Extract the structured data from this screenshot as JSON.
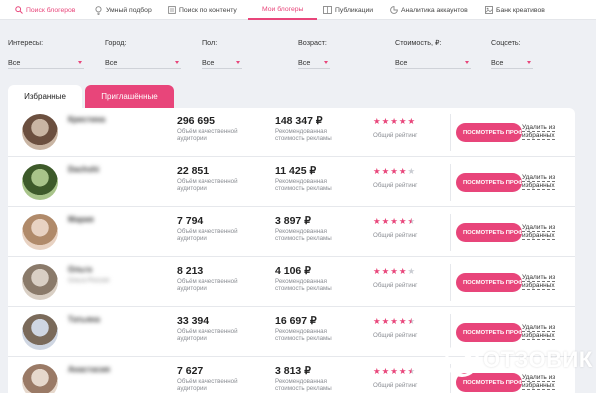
{
  "nav": {
    "items": [
      {
        "label": "Поиск блогеров",
        "icon": "search-icon"
      },
      {
        "label": "Умный подбор",
        "icon": "lightbulb-icon"
      },
      {
        "label": "Поиск по контенту",
        "icon": "content-search-icon"
      },
      {
        "label": "Мои блогеры",
        "icon": ""
      },
      {
        "label": "Публикации",
        "icon": "publications-icon"
      },
      {
        "label": "Аналитика аккаунтов",
        "icon": "analytics-icon"
      },
      {
        "label": "Банк креативов",
        "icon": "creatives-icon"
      }
    ],
    "active_index": 3
  },
  "filters": [
    {
      "label": "Интересы:",
      "value": "Все"
    },
    {
      "label": "Город:",
      "value": "Все"
    },
    {
      "label": "Пол:",
      "value": "Все"
    },
    {
      "label": "Возраст:",
      "value": "Все"
    },
    {
      "label": "Стоимость, ₽:",
      "value": "Все"
    },
    {
      "label": "Соцсеть:",
      "value": "Все"
    }
  ],
  "tabs": {
    "favorites": "Избранные",
    "invited": "Приглашённые"
  },
  "labels": {
    "audience_caption": "Объём качественной аудитории",
    "price_caption": "Рекомендованная стоимость рекламы",
    "rating_caption": "Общий рейтинг",
    "view_profile": "ПОСМОТРЕТЬ ПРОФИЛЬ",
    "remove": "Удалить из избранных"
  },
  "bloggers": [
    {
      "name": "Кристина",
      "sub": "",
      "audience": "296 695",
      "price": "148 347 ₽",
      "rating": [
        1,
        1,
        1,
        1,
        1
      ]
    },
    {
      "name": "Dachshi",
      "sub": "",
      "audience": "22 851",
      "price": "11 425 ₽",
      "rating": [
        1,
        1,
        1,
        1,
        0
      ]
    },
    {
      "name": "Мария",
      "sub": "",
      "audience": "7 794",
      "price": "3 897 ₽",
      "rating": [
        1,
        1,
        1,
        1,
        0.5
      ]
    },
    {
      "name": "Ольга",
      "sub": "Ольга Россия",
      "audience": "8 213",
      "price": "4 106 ₽",
      "rating": [
        1,
        1,
        1,
        1,
        0
      ]
    },
    {
      "name": "Татьяна",
      "sub": "",
      "audience": "33 394",
      "price": "16 697 ₽",
      "rating": [
        1,
        1,
        1,
        1,
        0.5
      ]
    },
    {
      "name": "Анастасия",
      "sub": "",
      "audience": "7 627",
      "price": "3 813 ₽",
      "rating": [
        1,
        1,
        1,
        1,
        0.5
      ]
    }
  ],
  "watermark": "ОТЗОВИК",
  "colors": {
    "accent": "#e8457a",
    "background": "#eef0f4"
  }
}
